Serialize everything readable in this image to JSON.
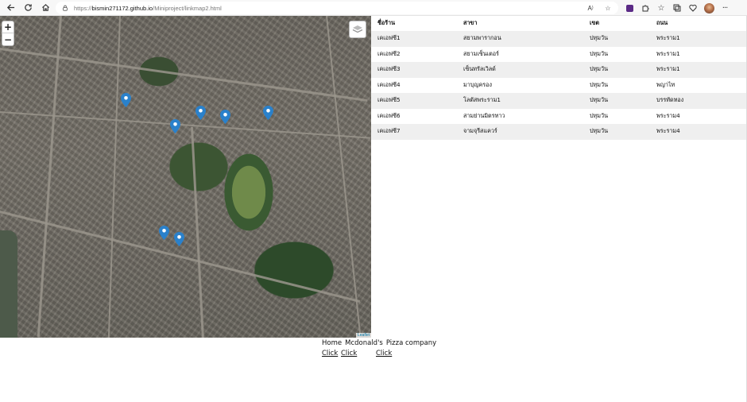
{
  "browser": {
    "url_prefix": "https://",
    "url_host": "bismin271172.github.io",
    "url_path": "/Miniproject/linkmap2.html"
  },
  "map": {
    "zoom_in": "+",
    "zoom_out": "−",
    "attribution": "Leaflet",
    "pin_color": "#2a81cb"
  },
  "table": {
    "headers": [
      "ชื่อร้าน",
      "สาขา",
      "เขต",
      "ถนน"
    ],
    "rows": [
      [
        "เคเอฟซี1",
        "สยามพารากอน",
        "ปทุมวัน",
        "พระราม1"
      ],
      [
        "เคเอฟซี2",
        "สยามเซ็นเตอร์",
        "ปทุมวัน",
        "พระราม1"
      ],
      [
        "เคเอฟซี3",
        "เซ็นทรัลเวิลด์",
        "ปทุมวัน",
        "พระราม1"
      ],
      [
        "เคเอฟซี4",
        "มาบุญครอง",
        "ปทุมวัน",
        "พญาไท"
      ],
      [
        "เคเอฟซี5",
        "โลตัสพระราม1",
        "ปทุมวัน",
        "บรรทัดทอง"
      ],
      [
        "เคเอฟซี6",
        "สามย่านมิตรทาว",
        "ปทุมวัน",
        "พระราม4"
      ],
      [
        "เคเอฟซี7",
        "จามจุรีสแควร์",
        "ปทุมวัน",
        "พระราม4"
      ]
    ]
  },
  "footer": {
    "links": [
      "Home",
      "Mcdonald's",
      "Pizza company"
    ],
    "clicks": [
      "Click",
      "Click",
      "Click"
    ]
  }
}
